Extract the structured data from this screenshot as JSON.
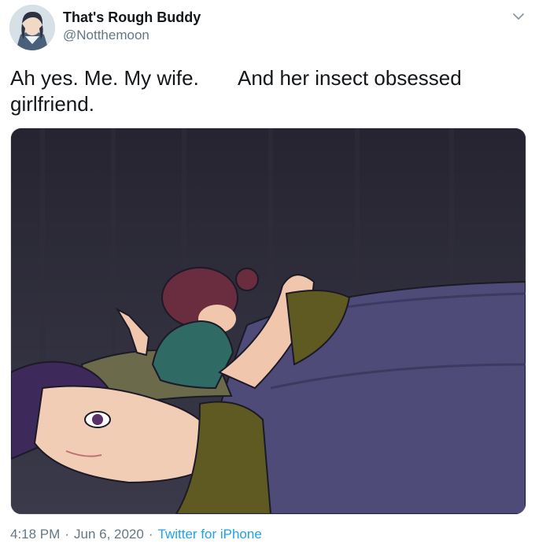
{
  "tweet": {
    "display_name": "That's Rough Buddy",
    "handle": "@Notthemoon",
    "text": "Ah yes. Me. My wife.       And her insect obsessed girlfriend.",
    "time": "4:18 PM",
    "separator": "·",
    "date": "Jun 6, 2020",
    "source": "Twitter for iPhone"
  },
  "icons": {
    "menu": "chevron-down-icon",
    "avatar": "avatar-image",
    "media": "anime-illustration-image"
  }
}
